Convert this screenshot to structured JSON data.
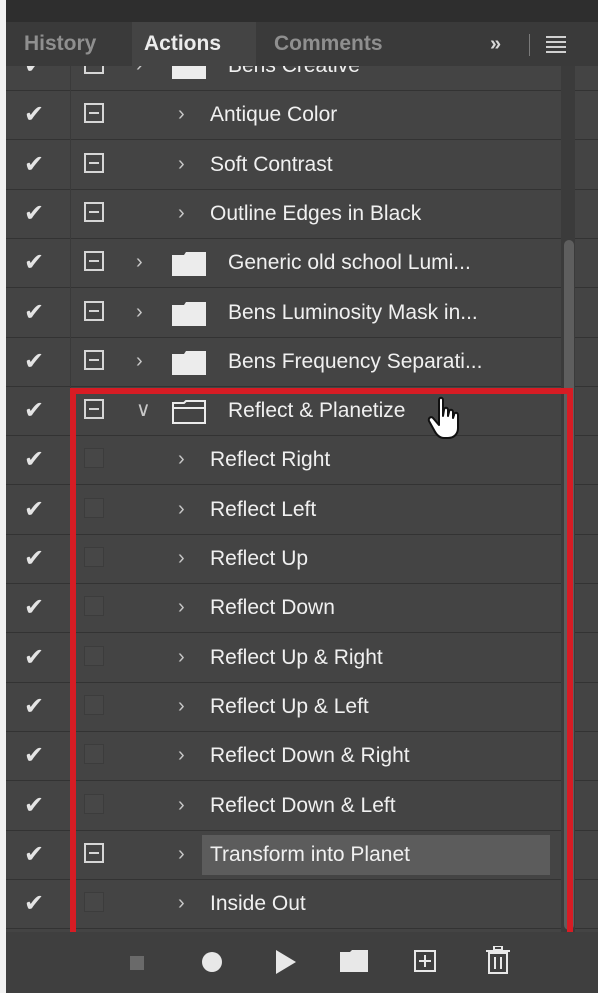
{
  "tabs": [
    {
      "label": "History",
      "active": false
    },
    {
      "label": "Actions",
      "active": true
    },
    {
      "label": "Comments",
      "active": false
    }
  ],
  "tabbar_icons": {
    "overflow": "double-chevron-right-icon",
    "menu": "hamburger-menu-icon"
  },
  "rows": [
    {
      "label": "Bens Creative",
      "checked": true,
      "toggle": true,
      "type": "set"
    },
    {
      "label": "Antique Color",
      "checked": true,
      "toggle": true,
      "type": "action"
    },
    {
      "label": "Soft Contrast",
      "checked": true,
      "toggle": true,
      "type": "action"
    },
    {
      "label": "Outline Edges in Black",
      "checked": true,
      "toggle": true,
      "type": "action"
    },
    {
      "label": "Generic old school Lumi...",
      "checked": true,
      "toggle": true,
      "type": "set"
    },
    {
      "label": "Bens Luminosity Mask in...",
      "checked": true,
      "toggle": true,
      "type": "set"
    },
    {
      "label": "Bens Frequency Separati...",
      "checked": true,
      "toggle": true,
      "type": "set"
    },
    {
      "label": "Reflect & Planetize",
      "checked": true,
      "toggle": true,
      "type": "set",
      "expanded": true
    },
    {
      "label": "Reflect Right",
      "checked": true,
      "toggle": false,
      "type": "action"
    },
    {
      "label": "Reflect Left",
      "checked": true,
      "toggle": false,
      "type": "action"
    },
    {
      "label": "Reflect Up",
      "checked": true,
      "toggle": false,
      "type": "action"
    },
    {
      "label": "Reflect Down",
      "checked": true,
      "toggle": false,
      "type": "action"
    },
    {
      "label": "Reflect Up & Right",
      "checked": true,
      "toggle": false,
      "type": "action"
    },
    {
      "label": "Reflect Up & Left",
      "checked": true,
      "toggle": false,
      "type": "action"
    },
    {
      "label": "Reflect Down & Right",
      "checked": true,
      "toggle": false,
      "type": "action"
    },
    {
      "label": "Reflect Down & Left",
      "checked": true,
      "toggle": false,
      "type": "action"
    },
    {
      "label": "Transform into Planet",
      "checked": true,
      "toggle": true,
      "type": "action",
      "selected": true
    },
    {
      "label": "Inside Out",
      "checked": true,
      "toggle": false,
      "type": "action"
    }
  ],
  "bottom_icons": [
    "stop-icon",
    "record-icon",
    "play-icon",
    "new-set-folder-icon",
    "new-action-icon",
    "delete-trash-icon"
  ],
  "colors": {
    "panel": "#444444",
    "highlight": "#d71c24",
    "selected_row": "#5c5c5c"
  }
}
